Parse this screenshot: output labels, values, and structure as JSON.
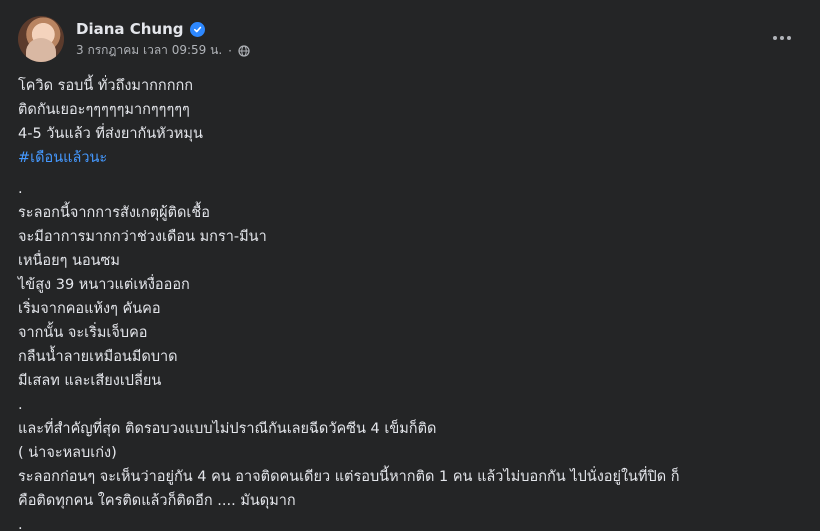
{
  "post": {
    "author": {
      "name": "Diana Chung",
      "verified_icon": "verified-badge-icon",
      "avatar_icon": "avatar"
    },
    "meta": {
      "timestamp": "3 กรกฎาคม เวลา 09:59 น.",
      "separator": "·",
      "audience_icon": "globe-icon"
    },
    "menu_icon": "more-options-icon",
    "body": {
      "line1": "โควิด รอบนี้ ทั่วถึงมากกกกก",
      "line2": "ติดกันเยอะๆๆๆๆๆมากๆๆๆๆๆ",
      "line3": "4-5 วันแล้ว ที่ส่งยากันหัวหมุน",
      "hashtag": "#เดือนแล้วนะ",
      "dot1": ".",
      "line4": "ระลอกนี้จากการสังเกตุผู้ติดเชื้อ",
      "line5": "จะมีอาการมากกว่าช่วงเดือน มกรา-มีนา",
      "line6": "เหนื่อยๆ นอนซม",
      "line7": "ไข้สูง 39 หนาวแต่เหงื่อออก",
      "line8": "เริ่มจากคอแห้งๆ คันคอ",
      "line9": "จากนั้น จะเริ่มเจ็บคอ",
      "line10": "กลืนน้ำลายเหมือนมีดบาด",
      "line11": "มีเสลท และเสียงเปลี่ยน",
      "dot2": ".",
      "line12": "และที่สำคัญที่สุด ติดรอบวงแบบไม่ปราณีกันเลยฉีดวัคซีน 4 เข็มก็ติด",
      "line13": "( น่าจะหลบเก่ง)",
      "line14": "ระลอกก่อนๆ จะเห็นว่าอยู่กัน 4 คน อาจติดคนเดียว แต่รอบนี้หากติด 1 คน แล้วไม่บอกกัน ไปนั่งอยู่ในที่ปิด ก็",
      "line15": "คือติดทุกคน ใครติดแล้วก็ติดอีก .... มันดุมาก",
      "dot3": "."
    }
  },
  "colors": {
    "background": "#242526",
    "text": "#e4e6eb",
    "secondary_text": "#b0b3b8",
    "link": "#4599ff",
    "verified": "#2d88ff"
  }
}
